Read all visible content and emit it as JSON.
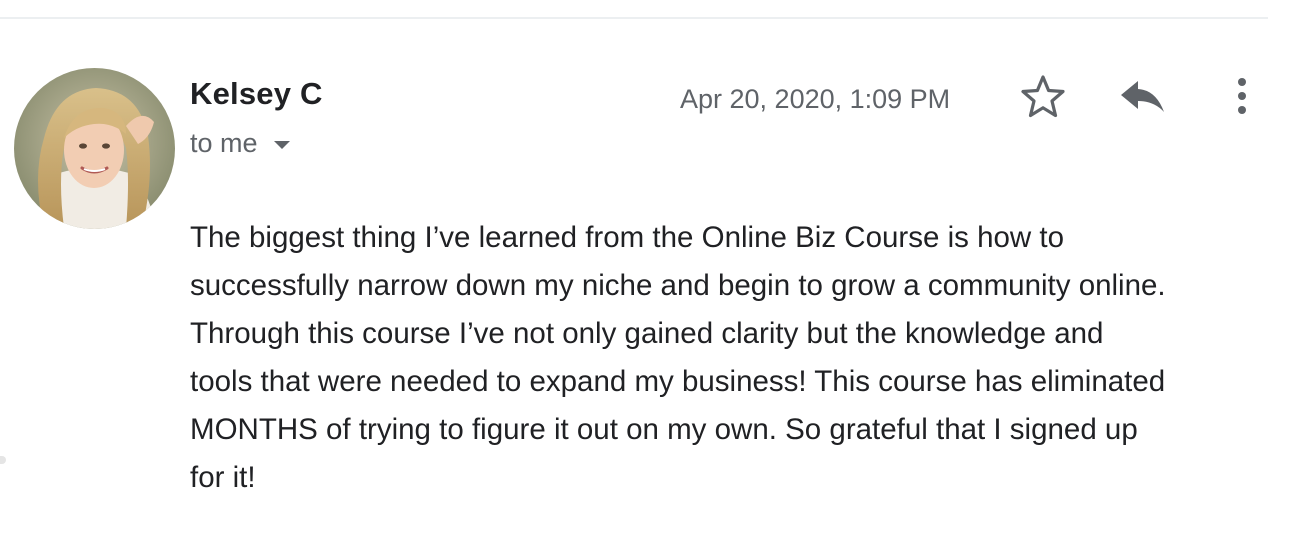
{
  "email": {
    "sender_name": "Kelsey C",
    "recipient_text": "to me",
    "timestamp": "Apr 20, 2020, 1:09 PM",
    "body_lines": [
      "The biggest thing I’ve learned from the Online Biz Course is how to",
      "successfully narrow down my niche and begin to grow a community online.",
      "Through this course I’ve not only gained clarity but the knowledge and",
      "tools that were needed to expand my business! This course has eliminated",
      "MONTHS of trying to figure it out on my own. So grateful that I signed up",
      "for it!"
    ]
  },
  "icons": {
    "recipient_dropdown": "caret-down-icon",
    "star": "star-outline-icon",
    "reply": "reply-icon",
    "more": "more-vertical-icon"
  },
  "colors": {
    "text_primary": "#202124",
    "text_secondary": "#5f6368",
    "divider": "#eceff1"
  }
}
